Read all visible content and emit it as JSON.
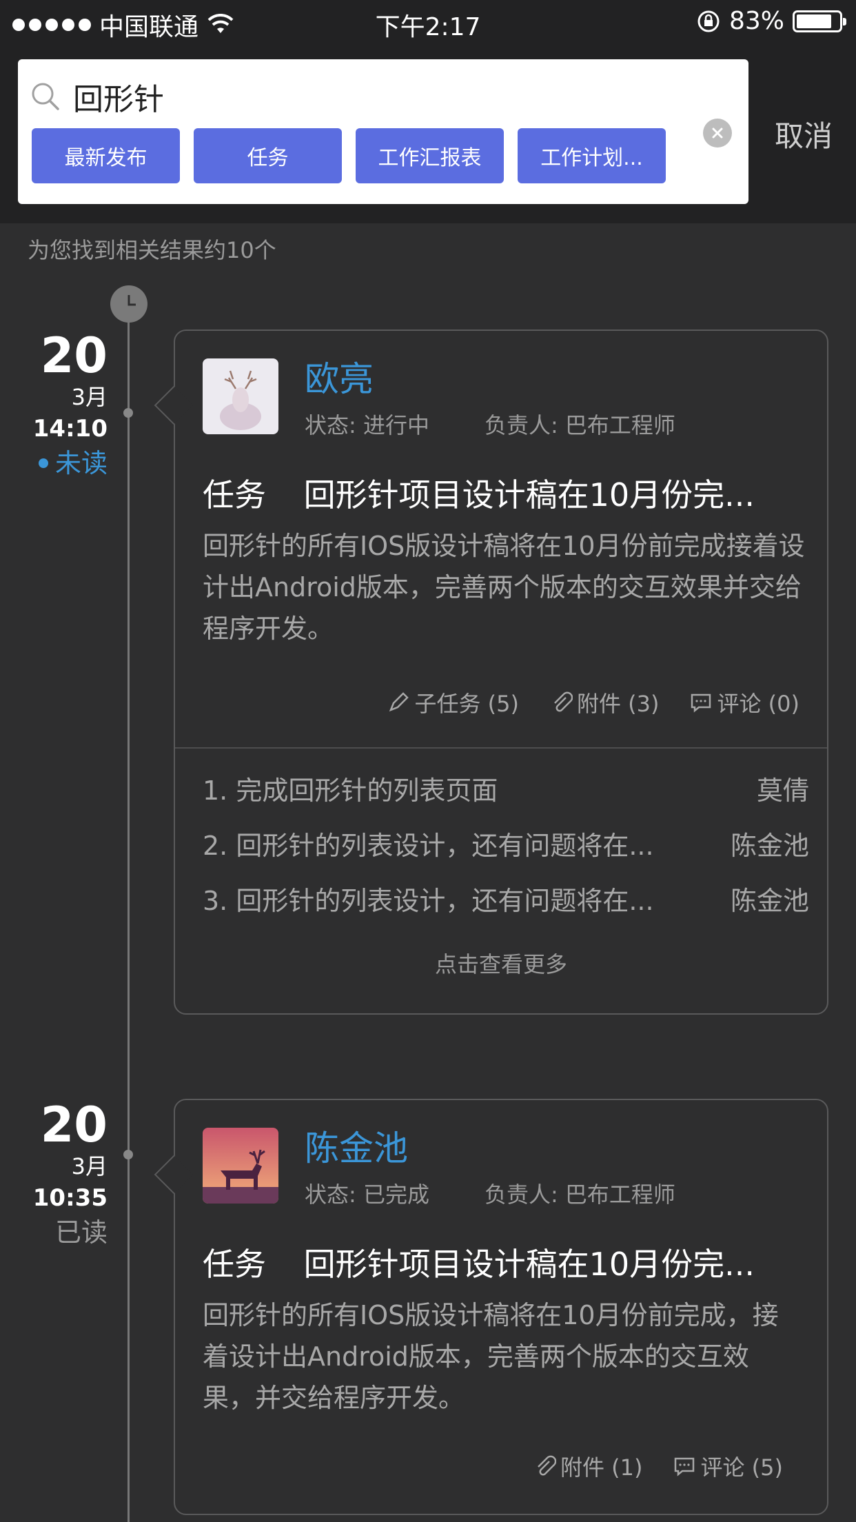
{
  "status_bar": {
    "carrier": "中国联通",
    "time": "下午2:17",
    "battery": "83%",
    "battery_level": 0.83
  },
  "search": {
    "query": "回形针",
    "chips": [
      "最新发布",
      "任务",
      "工作汇报表",
      "工作计划..."
    ],
    "cancel_label": "取消"
  },
  "result_count": "为您找到相关结果约10个",
  "entries": [
    {
      "day": "20",
      "month": "3月",
      "time": "14:10",
      "read_status": "未读",
      "name": "欧亮",
      "status": "状态: 进行中",
      "owner": "负责人: 巴布工程师",
      "tag": "任务",
      "title": "回形针项目设计稿在10月份完...",
      "desc": "回形针的所有IOS版设计稿将在10月份前完成接着设计出Android版本，完善两个版本的交互效果并交给程序开发。",
      "stats": [
        {
          "icon": "pencil-icon",
          "label": "子任务 (5)"
        },
        {
          "icon": "paperclip-icon",
          "label": "附件 (3)"
        },
        {
          "icon": "comment-icon",
          "label": "评论 (0)"
        }
      ],
      "subtasks": [
        {
          "title": "1. 完成回形针的列表页面",
          "owner": "莫倩"
        },
        {
          "title": "2. 回形针的列表设计，还有问题将在...",
          "owner": "陈金池"
        },
        {
          "title": "3. 回形针的列表设计，还有问题将在...",
          "owner": "陈金池"
        }
      ],
      "more_label": "点击查看更多"
    },
    {
      "day": "20",
      "month": "3月",
      "time": "10:35",
      "read_status": "已读",
      "name": "陈金池",
      "status": "状态: 已完成",
      "owner": "负责人: 巴布工程师",
      "tag": "任务",
      "title": "回形针项目设计稿在10月份完...",
      "desc": "回形针的所有IOS版设计稿将在10月份前完成，接着设计出Android版本，完善两个版本的交互效果，并交给程序开发。",
      "stats": [
        {
          "icon": "paperclip-icon",
          "label": "附件 (1)"
        },
        {
          "icon": "comment-icon",
          "label": "评论 (5)"
        }
      ]
    }
  ],
  "colors": {
    "accent_blue": "#3b96d8",
    "chip_blue": "#5b6de0",
    "background": "#2e2e2f"
  }
}
